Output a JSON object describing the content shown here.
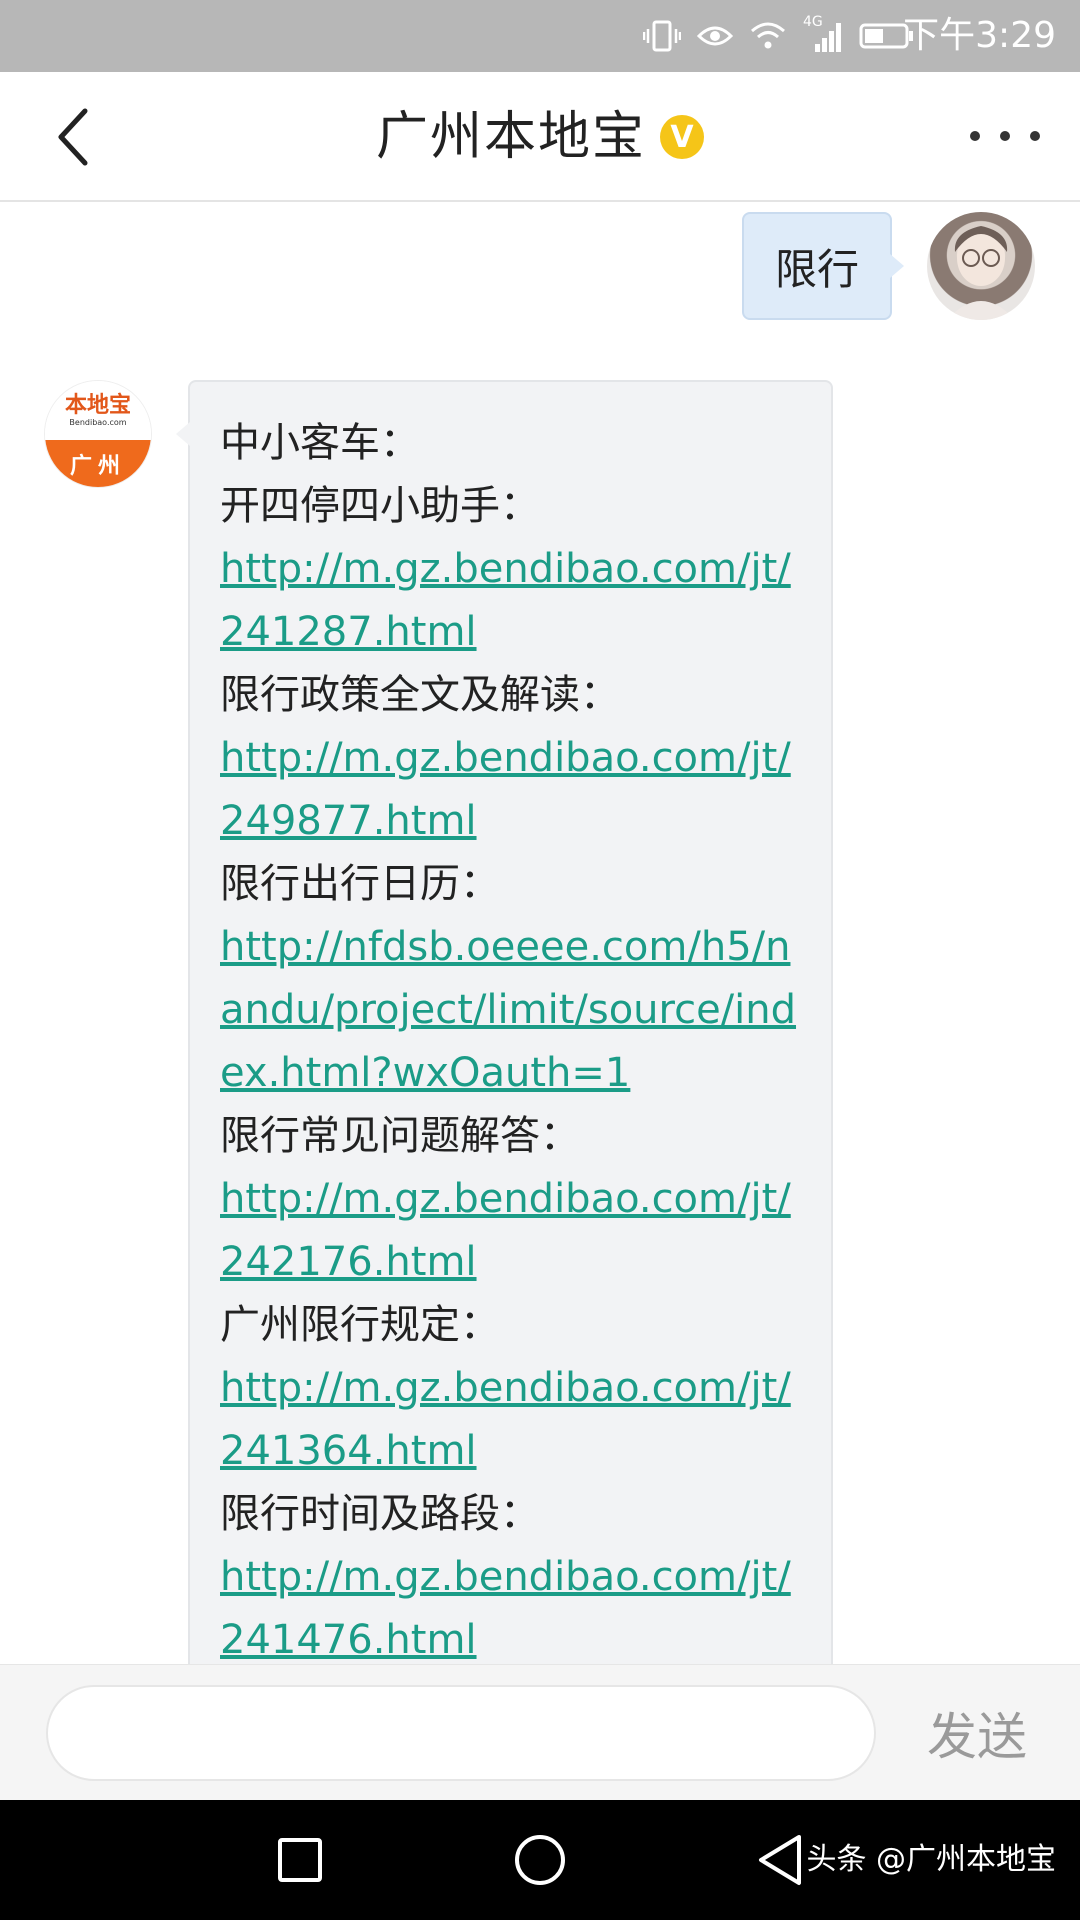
{
  "status_bar": {
    "time": "下午3:29",
    "network_label": "4G",
    "icons": [
      "vibrate-icon",
      "eye-icon",
      "wifi-icon",
      "signal-icon",
      "battery-icon"
    ]
  },
  "header": {
    "title": "广州本地宝",
    "verified_badge": "V"
  },
  "messages": {
    "user": {
      "text": "限行"
    },
    "bot": {
      "avatar_brand": "本地宝",
      "avatar_site": "Bendibao.com",
      "avatar_city": "广州",
      "lines": [
        {
          "type": "text",
          "value": "中小客车："
        },
        {
          "type": "text",
          "value": "开四停四小助手："
        },
        {
          "type": "link",
          "value": "http://m.gz.bendibao.com/jt/241287.html"
        },
        {
          "type": "text",
          "value": "限行政策全文及解读："
        },
        {
          "type": "link",
          "value": "http://m.gz.bendibao.com/jt/249877.html"
        },
        {
          "type": "text",
          "value": "限行出行日历："
        },
        {
          "type": "link",
          "value": "http://nfdsb.oeeee.com/h5/nandu/project/limit/source/index.html?wxOauth=1"
        },
        {
          "type": "text",
          "value": "限行常见问题解答："
        },
        {
          "type": "link",
          "value": "http://m.gz.bendibao.com/jt/242176.html"
        },
        {
          "type": "text",
          "value": "广州限行规定："
        },
        {
          "type": "link",
          "value": "http://m.gz.bendibao.com/jt/241364.html"
        },
        {
          "type": "text",
          "value": "限行时间及路段："
        },
        {
          "type": "link",
          "value": "http://m.gz.bendibao.com/jt/241476.html"
        }
      ]
    }
  },
  "input_bar": {
    "value": "",
    "send_label": "发送"
  },
  "nav_bar": {
    "watermark": "头条 @广州本地宝"
  },
  "colors": {
    "status_bar": "#b7b7b7",
    "link": "#1b9c87",
    "user_bubble": "#deebf9",
    "bot_bubble": "#f2f3f5",
    "verified": "#f5c518",
    "brand_orange": "#ef6a1c"
  }
}
